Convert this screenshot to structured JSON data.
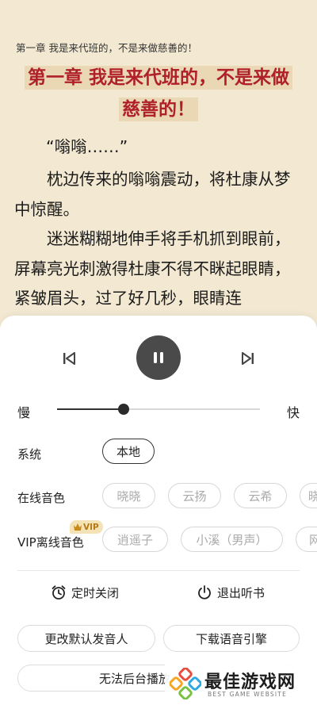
{
  "reader": {
    "chapter_small": "第一章 我是来代班的，不是来做慈善的！",
    "chapter_title_line1": "第一章 我是来代班的，不是来做",
    "chapter_title_line2": "慈善的！",
    "paragraph1": "“嗡嗡……”",
    "paragraph2": "枕边传来的嗡嗡震动，将杜康从梦中惊醒。",
    "paragraph3": "迷迷糊糊地伸手将手机抓到眼前，屏幕亮光刺激得杜康不得不眯起眼睛，紧皱眉头，过了好几秒，眼睛连"
  },
  "player": {
    "state": "playing",
    "speed": {
      "slow_label": "慢",
      "fast_label": "快",
      "level": 0.33
    }
  },
  "voices": {
    "system": {
      "label": "系统",
      "options": [
        "本地"
      ]
    },
    "online": {
      "label": "在线音色",
      "options": [
        "晓晓",
        "云扬",
        "云希",
        "晓"
      ]
    },
    "vip": {
      "label": "VIP离线音色",
      "badge": "VIP",
      "options": [
        "逍遥子",
        "小溪（男声）",
        "网"
      ]
    }
  },
  "actions": {
    "timer": "定时关闭",
    "exit": "退出听书",
    "change_voice": "更改默认发音人",
    "download_engine": "下载语音引擎",
    "background_play": "无法后台播放"
  },
  "watermark": {
    "title": "最佳游戏网",
    "subtitle": "BEST GAME WEBSITE",
    "colors": [
      "#e84c3d",
      "#f5a623",
      "#2fa8e0",
      "#7ac143"
    ]
  }
}
